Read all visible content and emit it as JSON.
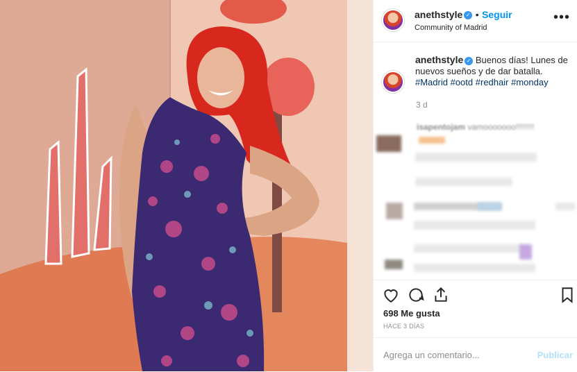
{
  "post": {
    "username": "anethstyle",
    "follow_separator": "•",
    "follow_label": "Seguir",
    "location": "Community of Madrid",
    "more_icon": "more-options-icon"
  },
  "caption": {
    "username": "anethstyle",
    "text": "Buenos días! Lunes de nuevos sueños y de dar batalla.",
    "hashtags": [
      "#Madrid",
      "#ootd",
      "#redhair",
      "#monday"
    ],
    "time": "3 d"
  },
  "comments": {
    "first_username": "isapentojam",
    "first_text": "vamooooooo!!!!!!!!"
  },
  "actions": {
    "likes": "698 Me gusta",
    "ago": "HACE 3 DÍAS"
  },
  "add_comment": {
    "placeholder": "Agrega un comentario...",
    "publish_label": "Publicar"
  }
}
